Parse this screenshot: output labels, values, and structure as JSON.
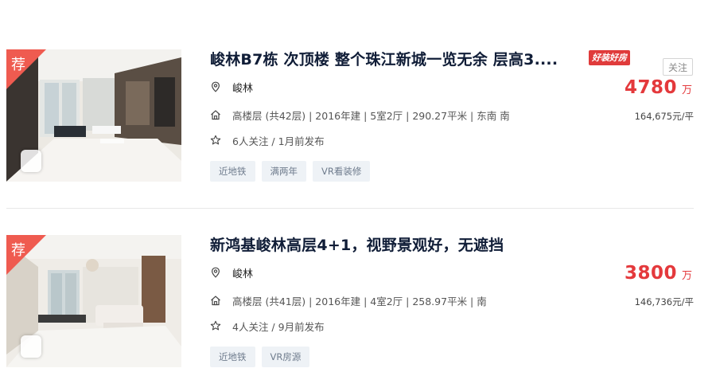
{
  "listings": [
    {
      "recommend_badge": "荐",
      "title": "峻林B7栋 次顶楼 整个珠江新城一览无余 层高3....",
      "hot_badge": "好装好房",
      "follow_button": "关注",
      "location": "峻林",
      "info": "高楼层 (共42层) | 2016年建 | 5室2厅 | 290.27平米 | 东南 南",
      "follow_info": "6人关注 / 1月前发布",
      "tags": [
        "近地铁",
        "满两年",
        "VR看装修"
      ],
      "price": "4780",
      "price_unit": "万",
      "unit_price": "164,675元/平",
      "icons": [
        "location-icon",
        "house-icon",
        "star-icon"
      ]
    },
    {
      "recommend_badge": "荐",
      "title": "新鸿基峻林高层4+1，视野景观好，无遮挡",
      "location": "峻林",
      "info": "高楼层 (共41层) | 2016年建 | 4室2厅 | 258.97平米 | 南",
      "follow_info": "4人关注 / 9月前发布",
      "tags": [
        "近地铁",
        "VR房源"
      ],
      "price": "3800",
      "price_unit": "万",
      "unit_price": "146,736元/平",
      "icons": [
        "location-icon",
        "house-icon",
        "star-icon"
      ]
    }
  ],
  "colors": {
    "title": "#101d37",
    "price": "#e4393c",
    "badge": "#ef5b50",
    "tag_bg": "#eef2f6",
    "tag_text": "#6f7c8d"
  }
}
